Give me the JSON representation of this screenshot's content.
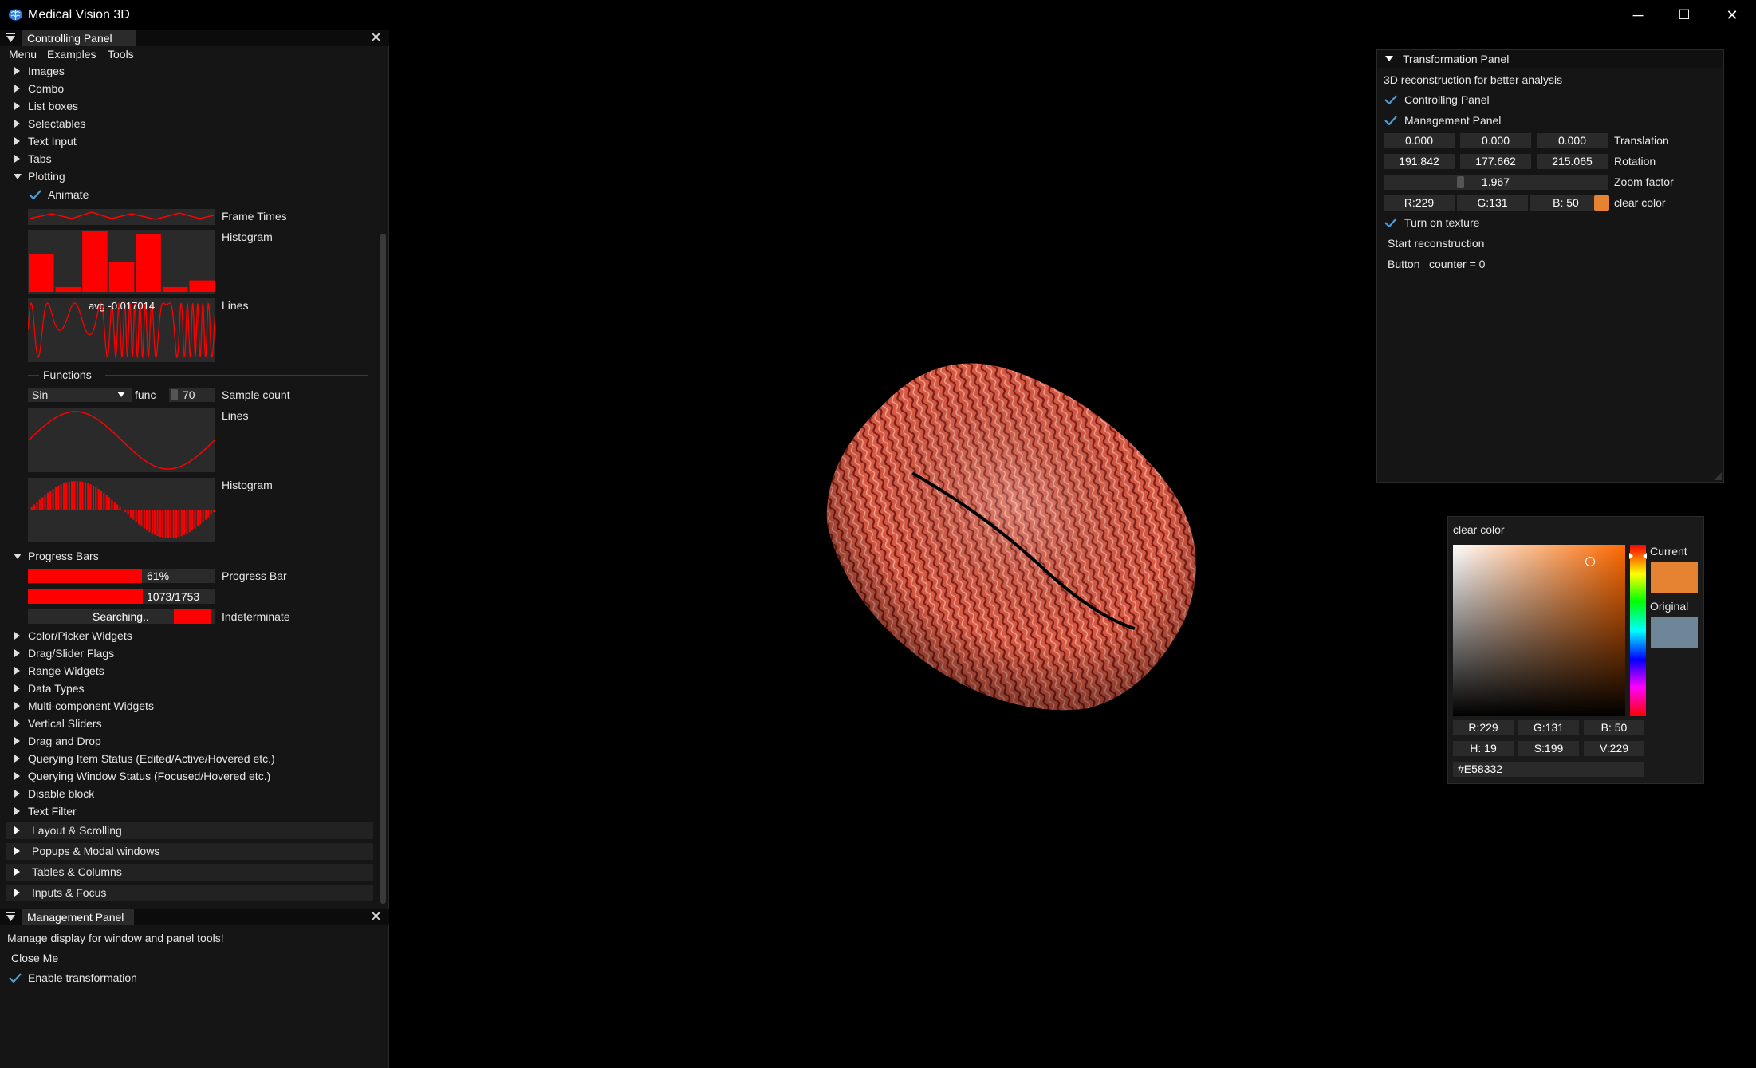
{
  "app": {
    "title": "Medical Vision 3D"
  },
  "window_controls": {
    "minimize": "─",
    "maximize": "☐",
    "close": "✕"
  },
  "controlling_panel": {
    "title": "Controlling Panel",
    "close": "✕",
    "menu": [
      "Menu",
      "Examples",
      "Tools"
    ],
    "items_top": [
      "Images",
      "Combo",
      "List boxes",
      "Selectables",
      "Text Input",
      "Tabs"
    ],
    "plotting": {
      "label": "Plotting",
      "animate": "Animate",
      "frame_times": "Frame Times",
      "histogram_label": "Histogram",
      "histogram_values": [
        0.62,
        0.08,
        1.0,
        0.5,
        0.96,
        0.08,
        0.19
      ],
      "lines_label": "Lines",
      "lines_overlay": "avg -0.017014",
      "functions_label": "Functions",
      "func_select": "Sin",
      "func_label": "func",
      "sample_count": "70",
      "sample_label": "Sample count",
      "func_lines_label": "Lines",
      "func_hist_label": "Histogram"
    },
    "progress": {
      "label": "Progress Bars",
      "bar1_text": "61%",
      "bar1_fraction": 0.61,
      "bar1_label": "Progress Bar",
      "bar2_text": "1073/1753",
      "bar2_fraction": 0.612,
      "indeterminate_text": "Searching..",
      "indeterminate_label": "Indeterminate"
    },
    "items_bottom": [
      "Color/Picker Widgets",
      "Drag/Slider Flags",
      "Range Widgets",
      "Data Types",
      "Multi-component Widgets",
      "Vertical Sliders",
      "Drag and Drop",
      "Querying Item Status (Edited/Active/Hovered etc.)",
      "Querying Window Status (Focused/Hovered etc.)",
      "Disable block",
      "Text Filter"
    ],
    "headers": [
      "Layout & Scrolling",
      "Popups & Modal windows",
      "Tables & Columns",
      "Inputs & Focus"
    ]
  },
  "management_panel": {
    "title": "Management Panel",
    "close": "✕",
    "description": "Manage display for window and panel tools!",
    "close_me": "Close Me",
    "enable_transformation": "Enable transformation"
  },
  "transformation_panel": {
    "title": "Transformation Panel",
    "subtitle": "3D reconstruction for better analysis",
    "controlling_panel": "Controlling Panel",
    "management_panel": "Management Panel",
    "translation": [
      "0.000",
      "0.000",
      "0.000"
    ],
    "translation_label": "Translation",
    "rotation": [
      "191.842",
      "177.662",
      "215.065"
    ],
    "rotation_label": "Rotation",
    "zoom": "1.967",
    "zoom_label": "Zoom factor",
    "rgb": [
      "R:229",
      "G:131",
      "B: 50"
    ],
    "clear_color_label": "clear color",
    "clear_color": "#E58332",
    "turn_on_texture": "Turn on texture",
    "start_reconstruction": "Start reconstruction",
    "button": "Button",
    "counter": "counter = 0"
  },
  "color_picker": {
    "title": "clear color",
    "current_label": "Current",
    "original_label": "Original",
    "current_color": "#E58332",
    "original_color": "#6D8799",
    "rgb": [
      "R:229",
      "G:131",
      "B: 50"
    ],
    "hsv": [
      "H: 19",
      "S:199",
      "V:229"
    ],
    "hex": "#E58332"
  },
  "theme": {
    "accent": "#ff0000",
    "check": "#4a9eda",
    "panel_bg": "#151515",
    "field_bg": "#2a2a2a"
  }
}
